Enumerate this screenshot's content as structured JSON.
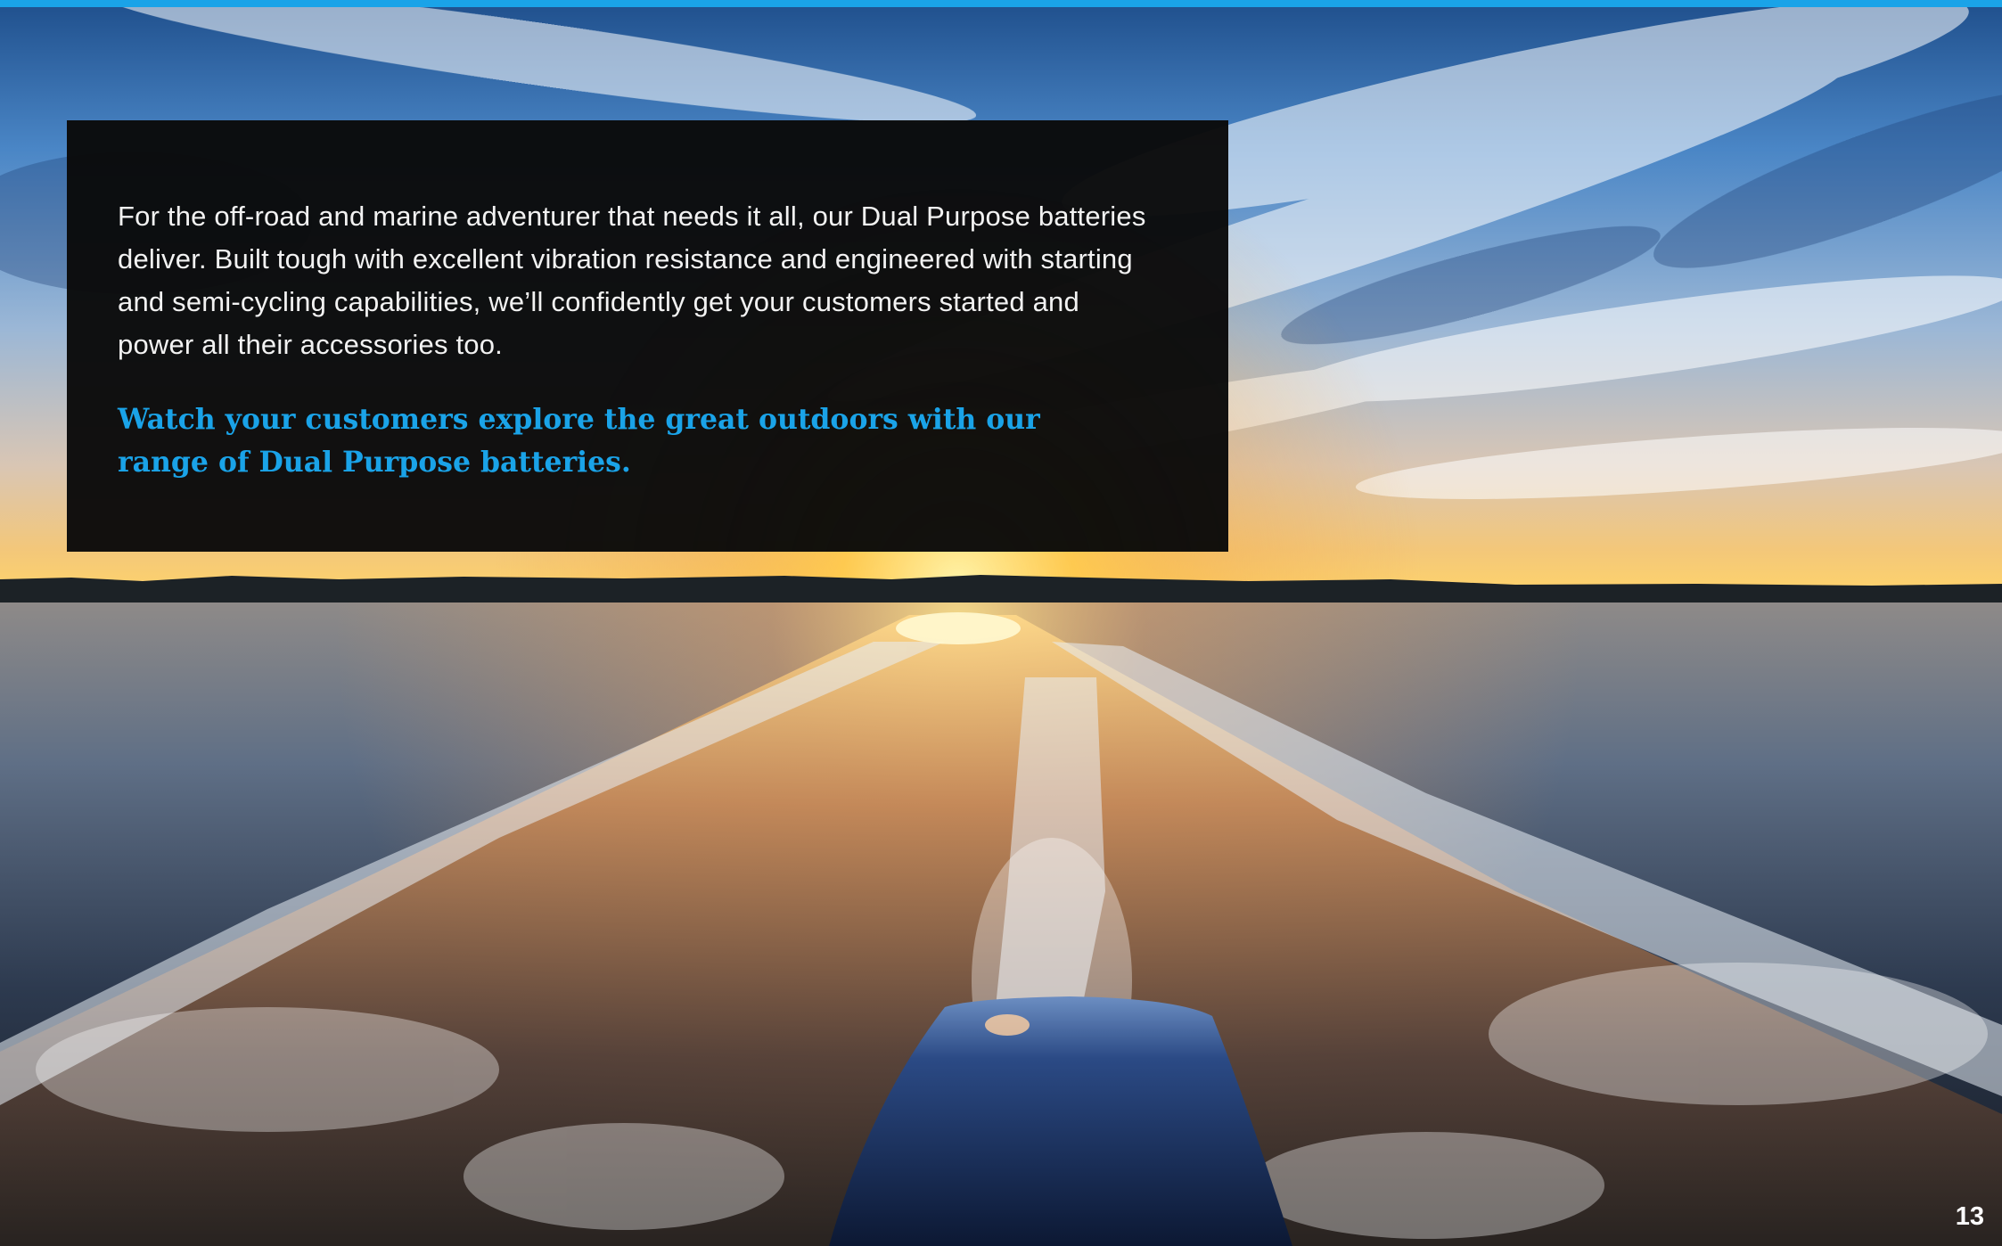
{
  "content": {
    "body_text": "For the off-road and marine adventurer that needs it all, our Dual Purpose batteries deliver. Built tough with excellent vibration resistance and engineered with starting and semi-cycling capabilities, we’ll confidently get your customers started and power all their accessories too.",
    "highlight_text": "Watch your customers explore the great outdoors with our range of Dual Purpose batteries."
  },
  "page_number": "13",
  "colors": {
    "accent": "#1aa3e8",
    "panel": "#0a0a0a",
    "body_text": "#f2f2f2"
  },
  "background_image": "boat-wake-sunset-photo"
}
